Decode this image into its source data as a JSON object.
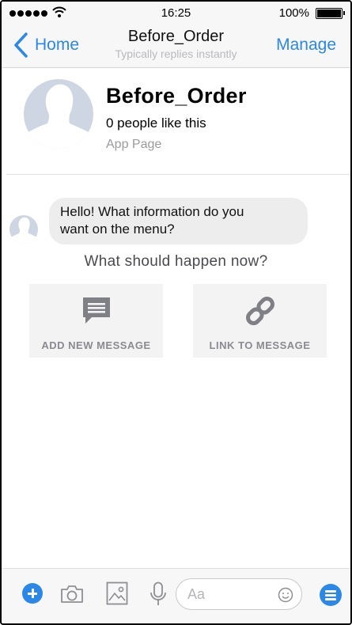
{
  "status_bar": {
    "time": "16:25",
    "battery": "100%"
  },
  "nav": {
    "back_label": "Home",
    "title": "Before_Order",
    "subtitle": "Typically replies instantly",
    "action_label": "Manage"
  },
  "page": {
    "name": "Before_Order",
    "likes": "0 people like this",
    "category": "App Page"
  },
  "conversation": {
    "message_line1": "Hello! What information do you",
    "message_line2": "want on the menu?",
    "prompt": "What should happen now?"
  },
  "actions": [
    {
      "label": "ADD NEW MESSAGE",
      "icon": "message-icon"
    },
    {
      "label": "LINK TO MESSAGE",
      "icon": "link-icon"
    }
  ],
  "composer": {
    "placeholder": "Aa"
  },
  "colors": {
    "accent": "#2b88e8",
    "bar": "#f7f7f8",
    "bubble": "#ededee",
    "card": "#f3f3f4",
    "avatar": "#cfd6e3"
  }
}
